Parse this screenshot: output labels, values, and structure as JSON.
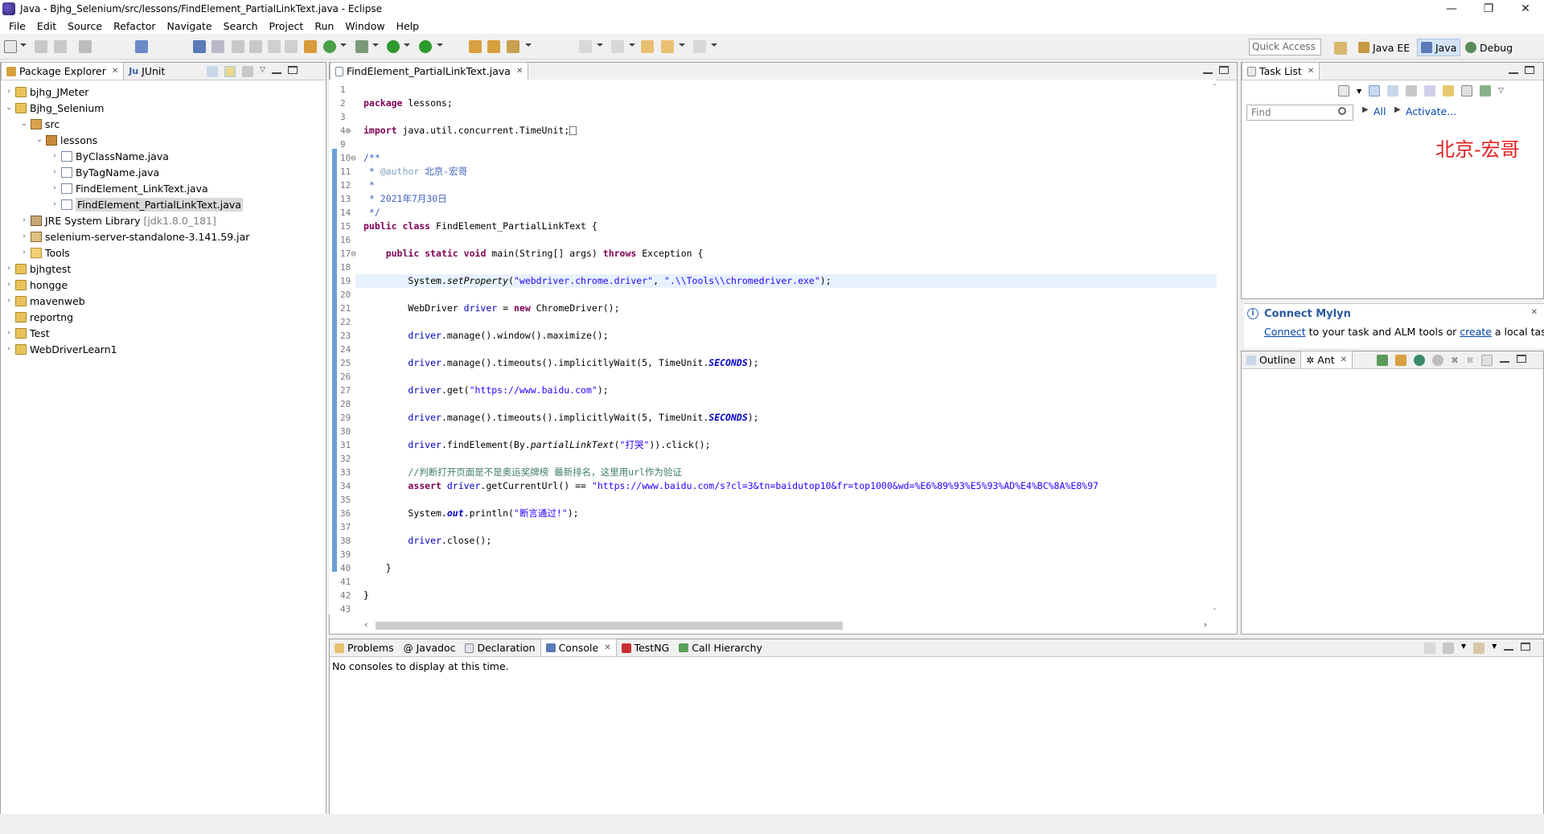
{
  "window": {
    "title": "Java - Bjhg_Selenium/src/lessons/FindElement_PartialLinkText.java - Eclipse",
    "minimize": "—",
    "maximize": "❐",
    "close": "✕"
  },
  "menu": [
    "File",
    "Edit",
    "Source",
    "Refactor",
    "Navigate",
    "Search",
    "Project",
    "Run",
    "Window",
    "Help"
  ],
  "quick_access": {
    "placeholder": "Quick Access"
  },
  "perspectives": [
    {
      "label": "Java EE",
      "active": false
    },
    {
      "label": "Java",
      "active": true
    },
    {
      "label": "Debug",
      "active": false
    }
  ],
  "left_tabs": [
    {
      "label": "Package Explorer",
      "active": true
    },
    {
      "label": "JUnit",
      "active": false
    }
  ],
  "tree": [
    {
      "label": "bjhg_JMeter",
      "twisty": "›",
      "icon": "project",
      "level": 0
    },
    {
      "label": "Bjhg_Selenium",
      "twisty": "⌄",
      "icon": "project",
      "level": 0
    },
    {
      "label": "src",
      "twisty": "⌄",
      "icon": "src-folder",
      "level": 1
    },
    {
      "label": "lessons",
      "twisty": "⌄",
      "icon": "package",
      "level": 2
    },
    {
      "label": "ByClassName.java",
      "twisty": "›",
      "icon": "java-file",
      "level": 3
    },
    {
      "label": "ByTagName.java",
      "twisty": "›",
      "icon": "java-file",
      "level": 3
    },
    {
      "label": "FindElement_LinkText.java",
      "twisty": "›",
      "icon": "java-file",
      "level": 3
    },
    {
      "label": "FindElement_PartialLinkText.java",
      "twisty": "›",
      "icon": "java-file",
      "level": 3,
      "selected": true
    },
    {
      "label": "JRE System Library",
      "suffix": "[jdk1.8.0_181]",
      "twisty": "›",
      "icon": "library",
      "level": 1
    },
    {
      "label": "selenium-server-standalone-3.141.59.jar",
      "twisty": "›",
      "icon": "jar",
      "level": 1
    },
    {
      "label": "Tools",
      "twisty": "›",
      "icon": "folder",
      "level": 1
    },
    {
      "label": "bjhgtest",
      "twisty": "›",
      "icon": "project",
      "level": 0
    },
    {
      "label": "hongge",
      "twisty": "›",
      "icon": "project",
      "level": 0
    },
    {
      "label": "mavenweb",
      "twisty": "›",
      "icon": "project",
      "level": 0
    },
    {
      "label": "reportng",
      "twisty": "",
      "icon": "project",
      "level": 0
    },
    {
      "label": "Test",
      "twisty": "›",
      "icon": "project",
      "level": 0
    },
    {
      "label": "WebDriverLearn1",
      "twisty": "›",
      "icon": "project",
      "level": 0
    }
  ],
  "editor": {
    "tab": "FindElement_PartialLinkText.java",
    "line_numbers": [
      "1",
      "2",
      "3",
      "4⊕",
      "9",
      "10⊖",
      "11",
      "12",
      "13",
      "14",
      "15",
      "16",
      "17⊖",
      "18",
      "19",
      "20",
      "21",
      "22",
      "23",
      "24",
      "25",
      "26",
      "27",
      "28",
      "29",
      "30",
      "31",
      "32",
      "33",
      "34",
      "35",
      "36",
      "37",
      "38",
      "39",
      "40",
      "41",
      "42",
      "43"
    ],
    "code": {
      "l2_kw": "package",
      "l2_rest": " lessons;",
      "l4_kw": "import",
      "l4_rest": " java.util.concurrent.TimeUnit;",
      "l10": "/**",
      "l11_pre": " * ",
      "l11_tag": "@author",
      "l11_rest": " 北京-宏哥",
      "l12": " *",
      "l13": " * 2021年7月30日",
      "l14": " */",
      "l15_kw1": "public",
      "l15_kw2": "class",
      "l15_rest": " FindElement_PartialLinkText {",
      "l17_kw1": "public",
      "l17_kw2": "static",
      "l17_kw3": "void",
      "l17_mid": " main(String[] args) ",
      "l17_kw4": "throws",
      "l17_rest": " Exception {",
      "l19_a": "System.",
      "l19_m": "setProperty",
      "l19_b": "(",
      "l19_s1": "\"webdriver.chrome.driver\"",
      "l19_c": ", ",
      "l19_s2": "\".\\\\Tools\\\\chromedriver.exe\"",
      "l19_d": ");",
      "l21_a": "WebDriver ",
      "l21_v": "driver",
      "l21_b": " = ",
      "l21_kw": "new",
      "l21_c": " ChromeDriver();",
      "l23_v": "driver",
      "l23_rest": ".manage().window().maximize();",
      "l25_v": "driver",
      "l25_a": ".manage().timeouts().implicitlyWait(5, TimeUnit.",
      "l25_f": "SECONDS",
      "l25_b": ");",
      "l27_v": "driver",
      "l27_a": ".get(",
      "l27_s": "\"https://www.baidu.com\"",
      "l27_b": ");",
      "l29_v": "driver",
      "l29_a": ".manage().timeouts().implicitlyWait(5, TimeUnit.",
      "l29_f": "SECONDS",
      "l29_b": ");",
      "l31_v": "driver",
      "l31_a": ".findElement(By.",
      "l31_m": "partialLinkText",
      "l31_b": "(",
      "l31_s": "\"打哭\"",
      "l31_c": ")).click();",
      "l33": "//判断打开页面是不是奥运奖牌榜 最新排名，这里用url作为验证",
      "l34_kw": "assert",
      "l34_v": " driver",
      "l34_a": ".getCurrentUrl() == ",
      "l34_s": "\"https://www.baidu.com/s?cl=3&tn=baidutop10&fr=top1000&wd=%E6%89%93%E5%93%AD%E4%BC%8A%E8%97",
      "l36_a": "System.",
      "l36_f": "out",
      "l36_b": ".println(",
      "l36_s": "\"断言通过!\"",
      "l36_c": ");",
      "l38_v": "driver",
      "l38_rest": ".close();",
      "l40": "}",
      "l42": "}"
    }
  },
  "right_top_tabs": [
    {
      "label": "Task List",
      "active": true
    }
  ],
  "task_list": {
    "find_placeholder": "Find",
    "all": "All",
    "activate": "Activate..."
  },
  "mylyn": {
    "title": "Connect Mylyn",
    "link1": "Connect",
    "text1": " to your task and ALM tools or ",
    "link2": "create",
    "text2": " a local task."
  },
  "right_bottom_tabs": [
    {
      "label": "Outline",
      "active": false
    },
    {
      "label": "Ant",
      "active": true
    }
  ],
  "bottom_tabs": [
    {
      "label": "Problems",
      "active": false
    },
    {
      "label": "Javadoc",
      "active": false
    },
    {
      "label": "Declaration",
      "active": false
    },
    {
      "label": "Console",
      "active": true
    },
    {
      "label": "TestNG",
      "active": false
    },
    {
      "label": "Call Hierarchy",
      "active": false
    }
  ],
  "console": {
    "message": "No consoles to display at this time."
  },
  "watermark": "北京-宏哥"
}
